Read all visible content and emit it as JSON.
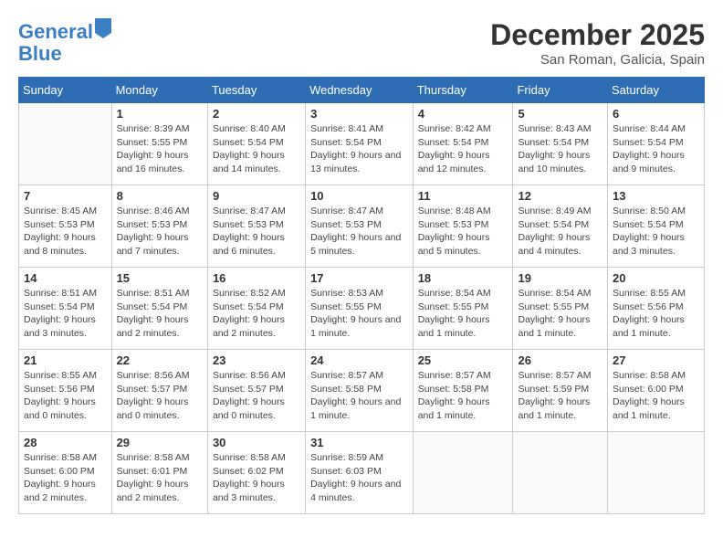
{
  "header": {
    "logo_line1": "General",
    "logo_line2": "Blue",
    "month": "December 2025",
    "location": "San Roman, Galicia, Spain"
  },
  "weekdays": [
    "Sunday",
    "Monday",
    "Tuesday",
    "Wednesday",
    "Thursday",
    "Friday",
    "Saturday"
  ],
  "weeks": [
    [
      {
        "day": "",
        "sunrise": "",
        "sunset": "",
        "daylight": ""
      },
      {
        "day": "1",
        "sunrise": "Sunrise: 8:39 AM",
        "sunset": "Sunset: 5:55 PM",
        "daylight": "Daylight: 9 hours and 16 minutes."
      },
      {
        "day": "2",
        "sunrise": "Sunrise: 8:40 AM",
        "sunset": "Sunset: 5:54 PM",
        "daylight": "Daylight: 9 hours and 14 minutes."
      },
      {
        "day": "3",
        "sunrise": "Sunrise: 8:41 AM",
        "sunset": "Sunset: 5:54 PM",
        "daylight": "Daylight: 9 hours and 13 minutes."
      },
      {
        "day": "4",
        "sunrise": "Sunrise: 8:42 AM",
        "sunset": "Sunset: 5:54 PM",
        "daylight": "Daylight: 9 hours and 12 minutes."
      },
      {
        "day": "5",
        "sunrise": "Sunrise: 8:43 AM",
        "sunset": "Sunset: 5:54 PM",
        "daylight": "Daylight: 9 hours and 10 minutes."
      },
      {
        "day": "6",
        "sunrise": "Sunrise: 8:44 AM",
        "sunset": "Sunset: 5:54 PM",
        "daylight": "Daylight: 9 hours and 9 minutes."
      }
    ],
    [
      {
        "day": "7",
        "sunrise": "Sunrise: 8:45 AM",
        "sunset": "Sunset: 5:53 PM",
        "daylight": "Daylight: 9 hours and 8 minutes."
      },
      {
        "day": "8",
        "sunrise": "Sunrise: 8:46 AM",
        "sunset": "Sunset: 5:53 PM",
        "daylight": "Daylight: 9 hours and 7 minutes."
      },
      {
        "day": "9",
        "sunrise": "Sunrise: 8:47 AM",
        "sunset": "Sunset: 5:53 PM",
        "daylight": "Daylight: 9 hours and 6 minutes."
      },
      {
        "day": "10",
        "sunrise": "Sunrise: 8:47 AM",
        "sunset": "Sunset: 5:53 PM",
        "daylight": "Daylight: 9 hours and 5 minutes."
      },
      {
        "day": "11",
        "sunrise": "Sunrise: 8:48 AM",
        "sunset": "Sunset: 5:53 PM",
        "daylight": "Daylight: 9 hours and 5 minutes."
      },
      {
        "day": "12",
        "sunrise": "Sunrise: 8:49 AM",
        "sunset": "Sunset: 5:54 PM",
        "daylight": "Daylight: 9 hours and 4 minutes."
      },
      {
        "day": "13",
        "sunrise": "Sunrise: 8:50 AM",
        "sunset": "Sunset: 5:54 PM",
        "daylight": "Daylight: 9 hours and 3 minutes."
      }
    ],
    [
      {
        "day": "14",
        "sunrise": "Sunrise: 8:51 AM",
        "sunset": "Sunset: 5:54 PM",
        "daylight": "Daylight: 9 hours and 3 minutes."
      },
      {
        "day": "15",
        "sunrise": "Sunrise: 8:51 AM",
        "sunset": "Sunset: 5:54 PM",
        "daylight": "Daylight: 9 hours and 2 minutes."
      },
      {
        "day": "16",
        "sunrise": "Sunrise: 8:52 AM",
        "sunset": "Sunset: 5:54 PM",
        "daylight": "Daylight: 9 hours and 2 minutes."
      },
      {
        "day": "17",
        "sunrise": "Sunrise: 8:53 AM",
        "sunset": "Sunset: 5:55 PM",
        "daylight": "Daylight: 9 hours and 1 minute."
      },
      {
        "day": "18",
        "sunrise": "Sunrise: 8:54 AM",
        "sunset": "Sunset: 5:55 PM",
        "daylight": "Daylight: 9 hours and 1 minute."
      },
      {
        "day": "19",
        "sunrise": "Sunrise: 8:54 AM",
        "sunset": "Sunset: 5:55 PM",
        "daylight": "Daylight: 9 hours and 1 minute."
      },
      {
        "day": "20",
        "sunrise": "Sunrise: 8:55 AM",
        "sunset": "Sunset: 5:56 PM",
        "daylight": "Daylight: 9 hours and 1 minute."
      }
    ],
    [
      {
        "day": "21",
        "sunrise": "Sunrise: 8:55 AM",
        "sunset": "Sunset: 5:56 PM",
        "daylight": "Daylight: 9 hours and 0 minutes."
      },
      {
        "day": "22",
        "sunrise": "Sunrise: 8:56 AM",
        "sunset": "Sunset: 5:57 PM",
        "daylight": "Daylight: 9 hours and 0 minutes."
      },
      {
        "day": "23",
        "sunrise": "Sunrise: 8:56 AM",
        "sunset": "Sunset: 5:57 PM",
        "daylight": "Daylight: 9 hours and 0 minutes."
      },
      {
        "day": "24",
        "sunrise": "Sunrise: 8:57 AM",
        "sunset": "Sunset: 5:58 PM",
        "daylight": "Daylight: 9 hours and 1 minute."
      },
      {
        "day": "25",
        "sunrise": "Sunrise: 8:57 AM",
        "sunset": "Sunset: 5:58 PM",
        "daylight": "Daylight: 9 hours and 1 minute."
      },
      {
        "day": "26",
        "sunrise": "Sunrise: 8:57 AM",
        "sunset": "Sunset: 5:59 PM",
        "daylight": "Daylight: 9 hours and 1 minute."
      },
      {
        "day": "27",
        "sunrise": "Sunrise: 8:58 AM",
        "sunset": "Sunset: 6:00 PM",
        "daylight": "Daylight: 9 hours and 1 minute."
      }
    ],
    [
      {
        "day": "28",
        "sunrise": "Sunrise: 8:58 AM",
        "sunset": "Sunset: 6:00 PM",
        "daylight": "Daylight: 9 hours and 2 minutes."
      },
      {
        "day": "29",
        "sunrise": "Sunrise: 8:58 AM",
        "sunset": "Sunset: 6:01 PM",
        "daylight": "Daylight: 9 hours and 2 minutes."
      },
      {
        "day": "30",
        "sunrise": "Sunrise: 8:58 AM",
        "sunset": "Sunset: 6:02 PM",
        "daylight": "Daylight: 9 hours and 3 minutes."
      },
      {
        "day": "31",
        "sunrise": "Sunrise: 8:59 AM",
        "sunset": "Sunset: 6:03 PM",
        "daylight": "Daylight: 9 hours and 4 minutes."
      },
      {
        "day": "",
        "sunrise": "",
        "sunset": "",
        "daylight": ""
      },
      {
        "day": "",
        "sunrise": "",
        "sunset": "",
        "daylight": ""
      },
      {
        "day": "",
        "sunrise": "",
        "sunset": "",
        "daylight": ""
      }
    ]
  ]
}
